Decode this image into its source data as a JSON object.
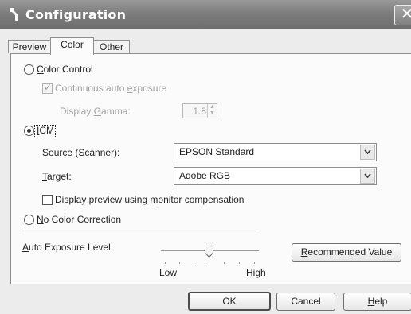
{
  "window": {
    "title": "Configuration",
    "close_glyph": "✕"
  },
  "tabs": [
    {
      "label": "Preview",
      "active": false
    },
    {
      "label": "Color",
      "active": true
    },
    {
      "label": "Other",
      "active": false
    }
  ],
  "color_control": {
    "radio_label_first": "C",
    "radio_label_rest": "olor Control",
    "selected": false,
    "auto_exposure": {
      "label_pre": "Continuous auto ",
      "label_key": "e",
      "label_post": "xposure",
      "checked": true,
      "disabled": true
    },
    "gamma": {
      "label_pre": "Display ",
      "label_key": "G",
      "label_post": "amma:",
      "value": "1.8",
      "disabled": true
    }
  },
  "icm": {
    "radio_label_first": "I",
    "radio_label_rest": "CM",
    "selected": true,
    "source": {
      "label_key": "S",
      "label_rest": "ource (Scanner):",
      "value": "EPSON Standard"
    },
    "target": {
      "label_key": "T",
      "label_rest": "arget:",
      "value": "Adobe RGB"
    },
    "monitor_comp": {
      "label_pre": "Display preview using ",
      "label_key": "m",
      "label_post": "onitor compensation",
      "checked": false
    }
  },
  "no_color": {
    "radio_label_first": "N",
    "radio_label_rest": "o Color Correction",
    "selected": false
  },
  "auto_exposure_level": {
    "label_key": "A",
    "label_rest": "uto Exposure Level",
    "low_label": "Low",
    "high_label": "High",
    "recommended_key": "R",
    "recommended_rest": "ecommended Value"
  },
  "buttons": {
    "ok": "OK",
    "cancel": "Cancel",
    "help_key": "H",
    "help_rest": "elp"
  },
  "icons": {
    "title": "wrench-icon",
    "dropdown": "chevron-down-icon"
  },
  "colors": {
    "titlebar": "#7d7d7d",
    "panel": "#fbfbfb",
    "disabled_text": "#a0a0a0"
  }
}
